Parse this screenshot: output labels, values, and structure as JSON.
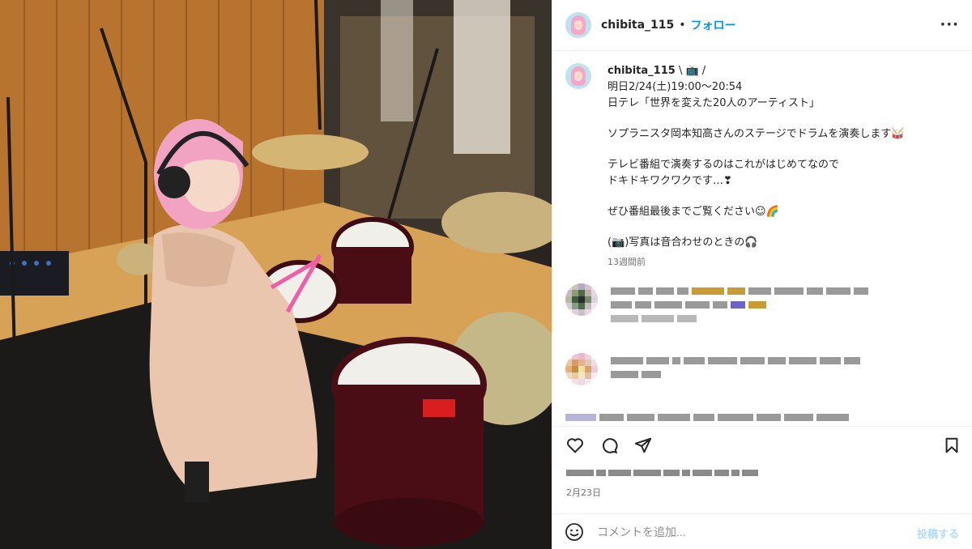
{
  "post": {
    "username": "chibita_115",
    "separator": "•",
    "follow_label": "フォロー",
    "more_label": "···"
  },
  "caption": {
    "username": "chibita_115",
    "lines": [
      "\\ 📺 /",
      "明日2/24(土)19:00〜20:54",
      "日テレ「世界を変えた20人のアーティスト」",
      "ソプラニスタ岡本知高さんのステージでドラムを演奏します🥁",
      "テレビ番組で演奏するのはこれがはじめてなので",
      "ドキドキワクワクです…❣",
      "ぜひ番組最後までご覧ください☺🌈",
      "(📷)写真は音合わせのときの🎧"
    ],
    "time_ago": "13週間前"
  },
  "post_date": "2月23日",
  "comment_box": {
    "placeholder": "コメントを追加...",
    "post_label": "投稿する"
  },
  "icons": [
    "more-icon",
    "emoji-icon",
    "like-icon",
    "comment-icon",
    "share-icon",
    "bookmark-icon"
  ],
  "colors": {
    "link_blue": "#0095f6",
    "post_disabled": "#b3dbff",
    "muted": "#737373"
  }
}
